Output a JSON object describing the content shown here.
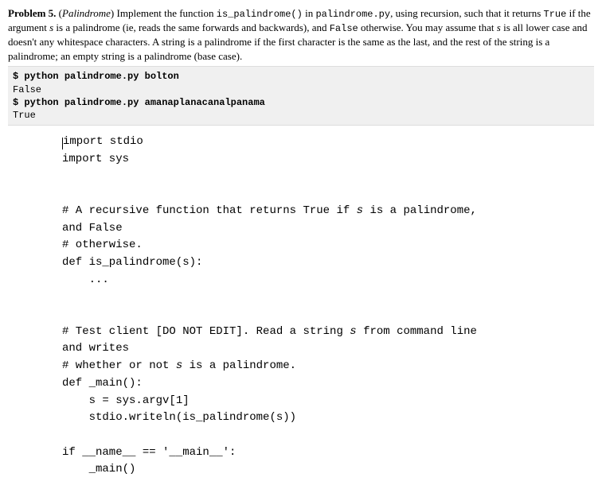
{
  "problem": {
    "label": "Problem 5.",
    "title": "Palindrome",
    "desc_before_fn": "Implement the function ",
    "fn_name": "is_palindrome()",
    "desc_after_fn": " in ",
    "file_name": "palindrome.py",
    "desc_rest1": ", using recursion, such that it returns ",
    "true_txt": "True",
    "desc_rest2": " if the argument ",
    "s_var": "s",
    "desc_rest3": " is a palindrome (ie, reads the same forwards and backwards), and ",
    "false_txt": "False",
    "desc_rest4": " otherwise. You may assume that ",
    "desc_rest5": " is all lower case and doesn't any whitespace characters. A string is a palindrome if the first character is the same as the last, and the rest of the string is a palindrome; an empty string is a palindrome (base case)."
  },
  "terminal": {
    "line1_prompt": "$ ",
    "line1_cmd": "python palindrome.py bolton",
    "line1_out": "False",
    "line2_prompt": "$ ",
    "line2_cmd": "python palindrome.py amanaplanacanalpanama",
    "line2_out": "True"
  },
  "code": {
    "l1": "import stdio",
    "l2": "import sys",
    "l3": "",
    "l4": "",
    "c1a": "# A recursive function that returns True if ",
    "c1s": "s",
    "c1b": " is a palindrome,",
    "c1c": "and False",
    "c2": "# otherwise.",
    "l5": "def is_palindrome(s):",
    "l6": "    ...",
    "l7": "",
    "l8": "",
    "c3a": "# Test client [DO NOT EDIT]. Read a string ",
    "c3s": "s",
    "c3b": " from command line",
    "c3c": "and writes",
    "c4a": "# whether or not ",
    "c4s": "s",
    "c4b": " is a palindrome.",
    "l9": "def _main():",
    "l10": "    s = sys.argv[1]",
    "l11": "    stdio.writeln(is_palindrome(s))",
    "l12": "",
    "l13": "if __name__ == '__main__':",
    "l14": "    _main()"
  }
}
